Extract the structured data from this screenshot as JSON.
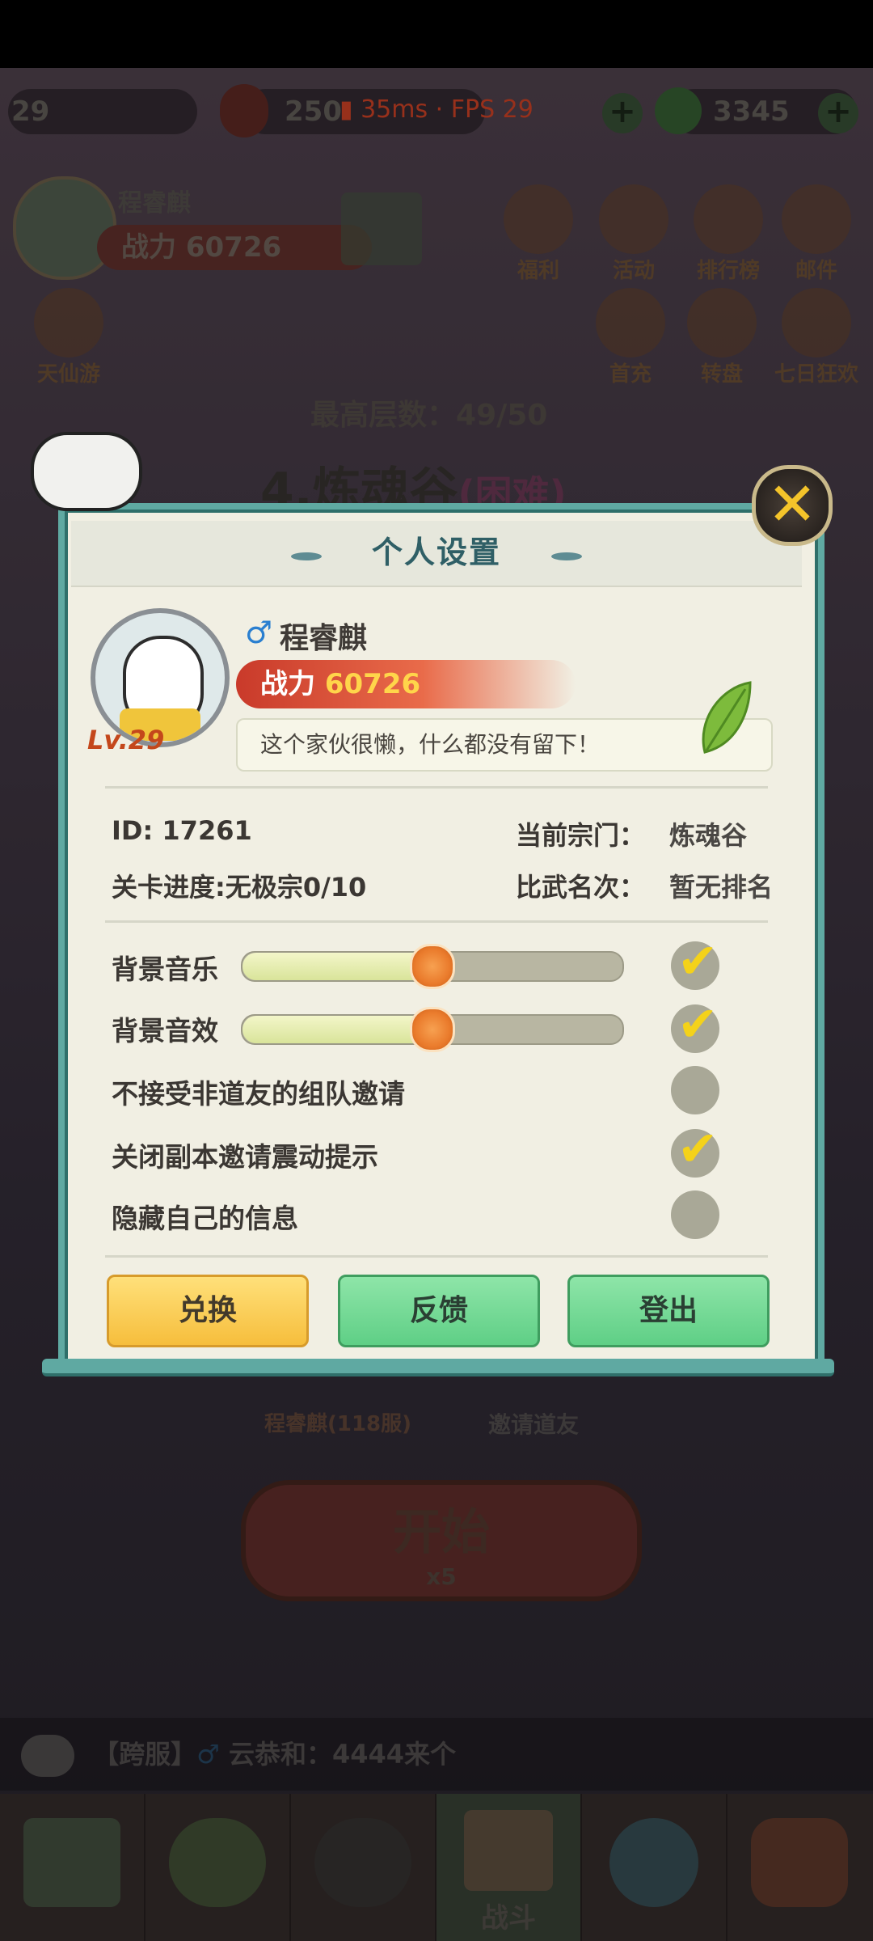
{
  "status_bar": {
    "ping": "35ms",
    "separator": "·",
    "fps": "FPS 29"
  },
  "top_resources": {
    "level": "29",
    "stamina": "250",
    "currency": "3345"
  },
  "player_bar": {
    "name": "程睿麒",
    "power_label": "战力",
    "power": "60726"
  },
  "top_icons": [
    "福利",
    "活动",
    "排行榜",
    "邮件"
  ],
  "second_icons": [
    "首充",
    "转盘",
    "七日狂欢"
  ],
  "left_icon": "天仙游",
  "stage": {
    "max_label": "最高层数：",
    "max_value": "49/50",
    "name": "4.炼魂谷",
    "difficulty": "(困难)"
  },
  "panel": {
    "title": "个人设置",
    "gender_symbol": "♂",
    "name": "程睿麒",
    "level": "Lv.29",
    "power_label": "战力",
    "power": "60726",
    "signature": "这个家伙很懒，什么都没有留下！",
    "id_label": "ID:",
    "id": "17261",
    "sect_label": "当前宗门：",
    "sect": "炼魂谷",
    "progress_label": "关卡进度:",
    "progress": "无极宗0/10",
    "rank_label": "比武名次：",
    "rank": "暂无排名",
    "settings": [
      {
        "label": "背景音乐",
        "slider": 0.5,
        "checked": true
      },
      {
        "label": "背景音效",
        "slider": 0.5,
        "checked": true
      },
      {
        "label": "不接受非道友的组队邀请",
        "checked": false
      },
      {
        "label": "关闭副本邀请震动提示",
        "checked": true
      },
      {
        "label": "隐藏自己的信息",
        "checked": false
      }
    ],
    "buttons": {
      "exchange": "兑换",
      "feedback": "反馈",
      "logout": "登出"
    }
  },
  "below": {
    "player_slot": "程睿麒(118服)",
    "invite": "邀请道友",
    "start": "开始",
    "cost": "x5"
  },
  "chat": {
    "channel": "【跨服】",
    "gender_symbol": "♂",
    "sender": "云恭和：",
    "message": "4444来个"
  },
  "nav": {
    "battle": "战斗"
  },
  "colors": {
    "panel_border": "#5fa9a2",
    "title": "#2f5f66",
    "power_bg": "#c93a2a",
    "exchange": "#f6be3c",
    "green_btn": "#5fcf86",
    "check": "#f4d21a"
  }
}
